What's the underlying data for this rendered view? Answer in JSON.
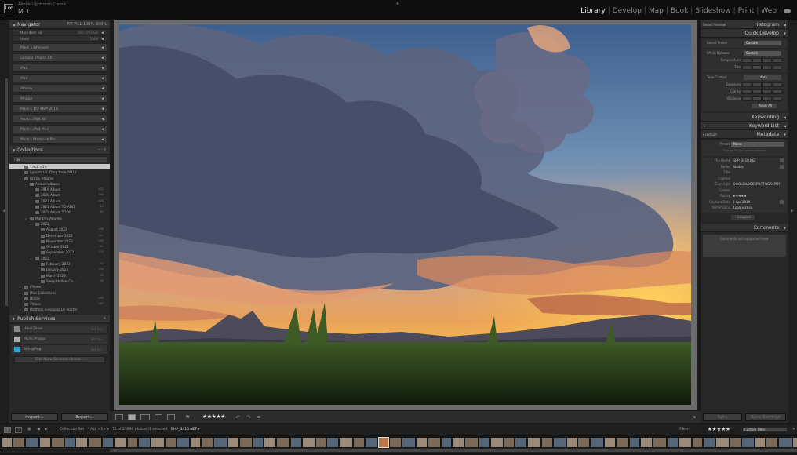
{
  "identity": {
    "app_line": "Adobe Lightroom Classic",
    "user_name": "M C"
  },
  "modules": [
    "Library",
    "Develop",
    "Map",
    "Book",
    "Slideshow",
    "Print",
    "Web"
  ],
  "active_module": "Library",
  "navigator": {
    "title": "Navigator",
    "zoom_levels": "FIT  FILL  100%  300%"
  },
  "devices": [
    {
      "label": "Macintosh HD",
      "count": "195 / 995 GB"
    },
    {
      "label": "Users",
      "count": "2329"
    },
    {
      "label": "Mark_Lightroom",
      "count": ""
    },
    {
      "label": "Elissa's iPhone XR",
      "count": ""
    },
    {
      "label": "iPad",
      "count": ""
    },
    {
      "label": "iPad",
      "count": ""
    },
    {
      "label": "iPhone",
      "count": ""
    },
    {
      "label": "iPhone",
      "count": ""
    },
    {
      "label": "Mark's 15\" MBP 2013",
      "count": ""
    },
    {
      "label": "Mark's iPad Air",
      "count": ""
    },
    {
      "label": "Mark's iPad Mini",
      "count": ""
    },
    {
      "label": "Mark's Macbook Pro",
      "count": ""
    }
  ],
  "collections": {
    "title": "Collections",
    "filter_placeholder": "Q▾",
    "items": [
      {
        "label": "* ALL <1>",
        "count": "",
        "indent": 1,
        "twisty": "▸",
        "selected": true
      },
      {
        "label": "Sync to LR (Drag from *ALL)",
        "count": "",
        "indent": 1,
        "twisty": "",
        "selected": false
      },
      {
        "label": "Family Albums",
        "count": "",
        "indent": 1,
        "twisty": "▾",
        "selected": false
      },
      {
        "label": "Annual Albums",
        "count": "",
        "indent": 2,
        "twisty": "▾",
        "selected": false
      },
      {
        "label": "2019 Album",
        "count": "402",
        "indent": 3,
        "twisty": "",
        "selected": false
      },
      {
        "label": "2020 Album",
        "count": "384",
        "indent": 3,
        "twisty": "",
        "selected": false
      },
      {
        "label": "2021 Album",
        "count": "304",
        "indent": 3,
        "twisty": "",
        "selected": false
      },
      {
        "label": "2021 Album TO ADD",
        "count": "11",
        "indent": 3,
        "twisty": "",
        "selected": false
      },
      {
        "label": "2022 Album TODO",
        "count": "81",
        "indent": 3,
        "twisty": "",
        "selected": false
      },
      {
        "label": "Monthly Albums",
        "count": "",
        "indent": 2,
        "twisty": "▾",
        "selected": false
      },
      {
        "label": "2022",
        "count": "",
        "indent": 3,
        "twisty": "▾",
        "selected": false
      },
      {
        "label": "August 2022",
        "count": "109",
        "indent": 4,
        "twisty": "",
        "selected": false
      },
      {
        "label": "December 2022",
        "count": "241",
        "indent": 4,
        "twisty": "",
        "selected": false
      },
      {
        "label": "November 2022",
        "count": "185",
        "indent": 4,
        "twisty": "",
        "selected": false
      },
      {
        "label": "October 2022",
        "count": "61",
        "indent": 4,
        "twisty": "",
        "selected": false
      },
      {
        "label": "September 2022",
        "count": "174",
        "indent": 4,
        "twisty": "",
        "selected": false
      },
      {
        "label": "2023",
        "count": "",
        "indent": 3,
        "twisty": "▾",
        "selected": false
      },
      {
        "label": "February 2023",
        "count": "54",
        "indent": 4,
        "twisty": "",
        "selected": false
      },
      {
        "label": "January 2023",
        "count": "304",
        "indent": 4,
        "twisty": "",
        "selected": false
      },
      {
        "label": "March 2023",
        "count": "32",
        "indent": 4,
        "twisty": "",
        "selected": false
      },
      {
        "label": "Sleep Hollow Ca...",
        "count": "35",
        "indent": 4,
        "twisty": "",
        "selected": false
      },
      {
        "label": "iPhone",
        "count": "",
        "indent": 1,
        "twisty": "▸",
        "selected": false
      },
      {
        "label": "Misc Collections",
        "count": "",
        "indent": 1,
        "twisty": "▸",
        "selected": false
      },
      {
        "label": "Drone",
        "count": "289",
        "indent": 1,
        "twisty": "",
        "selected": false
      },
      {
        "label": "Videos",
        "count": "167",
        "indent": 1,
        "twisty": "",
        "selected": false
      },
      {
        "label": "Portfolio (Lessons) LR Starter",
        "count": "",
        "indent": 1,
        "twisty": "▸",
        "selected": false
      }
    ]
  },
  "publish": {
    "title": "Publish Services",
    "items": [
      {
        "label": "Hard Drive",
        "status": "Set Up...",
        "color": "#888888"
      },
      {
        "label": "Mylio Photos",
        "status": "Set Up...",
        "color": "#aaaaaa"
      },
      {
        "label": "SmugMug",
        "status": "Set Up...",
        "color": "#2aa7d6"
      }
    ],
    "find_more": "Find More Services Online..."
  },
  "buttons": {
    "import": "Import...",
    "export": "Export...",
    "sync": "Sync",
    "sync_settings": "Sync Settings"
  },
  "histogram": {
    "title": "Histogram",
    "label": "Smart Preview"
  },
  "quick_develop": {
    "title": "Quick Develop",
    "saved_preset_label": "Saved Preset",
    "saved_preset_value": "Custom",
    "white_balance_label": "White Balance",
    "white_balance_value": "Custom",
    "temperature_label": "Temperature",
    "tint_label": "Tint",
    "tone_control_label": "Tone Control",
    "auto_label": "Auto",
    "exposure_label": "Exposure",
    "clarity_label": "Clarity",
    "vibrance_label": "Vibrance",
    "reset_all": "Reset All"
  },
  "keywording": {
    "title": "Keywording"
  },
  "keyword_list": {
    "title": "Keyword List"
  },
  "metadata": {
    "title": "Metadata",
    "view": "Default",
    "preset_label": "Preset",
    "preset_value": "None",
    "buttons": "Change Photo   Custom Settings",
    "fields": [
      {
        "label": "File Name",
        "value": "GHP_3410.NEF"
      },
      {
        "label": "Folder",
        "value": "Yandra"
      },
      {
        "label": "Title",
        "value": ""
      },
      {
        "label": "Caption",
        "value": ""
      },
      {
        "label": "Copyright",
        "value": "©GOLDILOCKSPHOTOGRAPHY"
      },
      {
        "label": "Creator",
        "value": ""
      },
      {
        "label": "Rating",
        "value": "★★★★★"
      },
      {
        "label": "Capture Date",
        "value": "1 Apr 2019"
      },
      {
        "label": "Dimensions",
        "value": "4256 x 2832"
      }
    ],
    "crop_label": "Cropped"
  },
  "comments": {
    "title": "Comments",
    "placeholder": "Comments not supported here."
  },
  "toolbar": {
    "rating": "★★★★★"
  },
  "filmstrip_bar": {
    "pages": [
      "1",
      "2"
    ],
    "source_prefix": "Collection Set : * ALL <1>",
    "counts": "72 of 25606 photos /1 selected /",
    "selected_file": "GHP_3410.NEF",
    "filter_label": "Filter:",
    "filter_stars": "★★★★★",
    "filter_value": "Custom Filter"
  },
  "colors": {
    "panel": "#272727",
    "header": "#333333",
    "selection": "#c8c8c8",
    "accent": "#e6e6e6"
  }
}
